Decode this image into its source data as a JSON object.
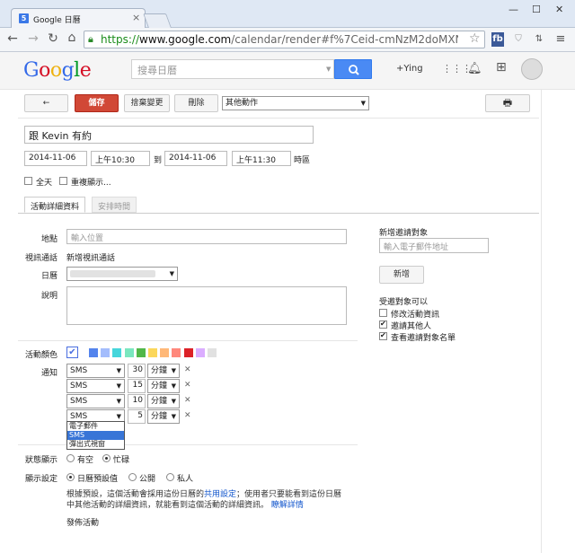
{
  "browser": {
    "tab_title": "Google 日曆",
    "favicon_text": "5",
    "url_scheme": "https://",
    "url_host": "www.google.com",
    "url_path": "/calendar/render#f%7Ceid-cmNzM2doMXNnNXBz",
    "ext_fb": "fb"
  },
  "header": {
    "logo_letters": [
      "G",
      "o",
      "o",
      "g",
      "l",
      "e"
    ],
    "logo_colors": [
      "#3369e8",
      "#d50f25",
      "#eeb211",
      "#3369e8",
      "#009925",
      "#d50f25"
    ],
    "search_placeholder": "搜尋日曆",
    "user": "+Ying"
  },
  "actions": {
    "back": "←",
    "save": "儲存",
    "discard": "捨棄變更",
    "delete": "刪除",
    "more": "其他動作",
    "print": "🖶"
  },
  "event": {
    "title": "跟 Kevin 有約",
    "start_date": "2014-11-06",
    "start_time": "上午10:30",
    "to": "到",
    "end_date": "2014-11-06",
    "end_time": "上午11:30",
    "timezone": "時區",
    "allday": "全天",
    "repeat": "重複顯示..."
  },
  "tabs": {
    "details": "活動詳細資料",
    "schedule": "安排時間"
  },
  "form": {
    "location_label": "地點",
    "location_placeholder": "輸入位置",
    "video_label": "視訊通話",
    "video_link": "新增視訊通話",
    "calendar_label": "日曆",
    "description_label": "說明",
    "color_label": "活動顏色",
    "notify_label": "通知",
    "status_label": "狀態顯示",
    "status_free": "有空",
    "status_busy": "忙碌",
    "visibility_label": "顯示設定",
    "vis_default": "日曆預設值",
    "vis_public": "公開",
    "vis_private": "私人",
    "note_pre": "根據預設，這個活動會採用這份日曆的",
    "note_link1": "共用設定",
    "note_mid": "；使用者只要能看到這份日曆中其他活動的詳細資訊，就能看到這個活動的詳細資訊。",
    "note_link2": "瞭解詳情",
    "publish": "發佈活動"
  },
  "colors": [
    "#5484ed",
    "#a4bdfc",
    "#46d6db",
    "#7ae7bf",
    "#51b749",
    "#fbd75b",
    "#ffb878",
    "#ff887c",
    "#dc2127",
    "#dbadff",
    "#e1e1e1"
  ],
  "reminders": [
    {
      "method": "SMS",
      "value": "30",
      "unit": "分鐘"
    },
    {
      "method": "SMS",
      "value": "15",
      "unit": "分鐘"
    },
    {
      "method": "SMS",
      "value": "10",
      "unit": "分鐘"
    },
    {
      "method": "SMS",
      "value": "5",
      "unit": "分鐘"
    }
  ],
  "method_options": [
    "電子郵件",
    "SMS",
    "彈出式視窗"
  ],
  "guests": {
    "heading": "新增邀請對象",
    "placeholder": "輸入電子郵件地址",
    "add": "新增",
    "perm_heading": "受邀對象可以",
    "perm_modify": "修改活動資訊",
    "perm_invite": "邀請其他人",
    "perm_list": "查看邀請對象名單"
  }
}
